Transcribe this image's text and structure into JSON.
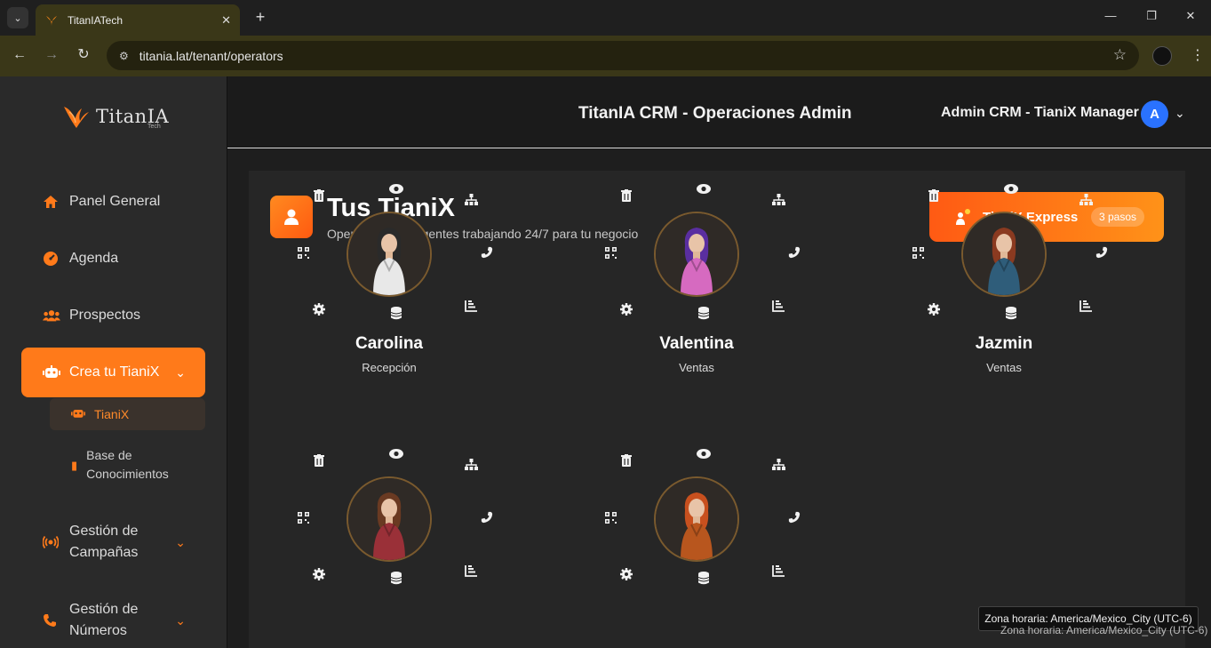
{
  "browser": {
    "tab_title": "TitanIATech",
    "url": "titania.lat/tenant/operators"
  },
  "sidebar": {
    "logo_text": "TitanIA",
    "logo_sub": "Tech",
    "items": [
      {
        "label": "Panel General",
        "icon": "home-icon"
      },
      {
        "label": "Agenda",
        "icon": "gauge-icon"
      },
      {
        "label": "Prospectos",
        "icon": "users-icon"
      },
      {
        "label": "Crea tu TianiX",
        "icon": "robot-icon",
        "active": true
      },
      {
        "label": "Gestión de Campañas",
        "icon": "broadcast-icon"
      },
      {
        "label": "Gestión de Números",
        "icon": "phone-icon"
      }
    ],
    "subitems": [
      {
        "label": "TianiX",
        "icon": "robot-icon",
        "active": true
      },
      {
        "label": "Base de Conocimientos",
        "icon": "book-icon"
      }
    ]
  },
  "header": {
    "title": "TitanIA CRM - Operaciones Admin",
    "user_name": "Admin CRM - TianiX Manager",
    "avatar_initial": "A"
  },
  "section": {
    "title": "Tus TianiX",
    "subtitle": "Operadores inteligentes trabajando 24/7 para tu negocio",
    "express_label": "TianiX Express",
    "express_badge": "3 pasos"
  },
  "operators": [
    {
      "name": "Carolina",
      "role": "Recepción",
      "outfit": "#e8e8e8",
      "hair": "#2a2a2a"
    },
    {
      "name": "Valentina",
      "role": "Ventas",
      "outfit": "#d66ac0",
      "hair": "#5a2ea0"
    },
    {
      "name": "Jazmin",
      "role": "Ventas",
      "outfit": "#2f5d7a",
      "hair": "#8a3a20"
    },
    {
      "name": "",
      "role": "",
      "outfit": "#9a3038",
      "hair": "#6a3a22"
    },
    {
      "name": "",
      "role": "",
      "outfit": "#b8561e",
      "hair": "#c8501e"
    }
  ],
  "tooltip": {
    "text": "Zona horaria: America/Mexico_City (UTC-6)"
  },
  "colors": {
    "accent": "#ff7a1a",
    "avatar_bg": "#2a72ff"
  }
}
